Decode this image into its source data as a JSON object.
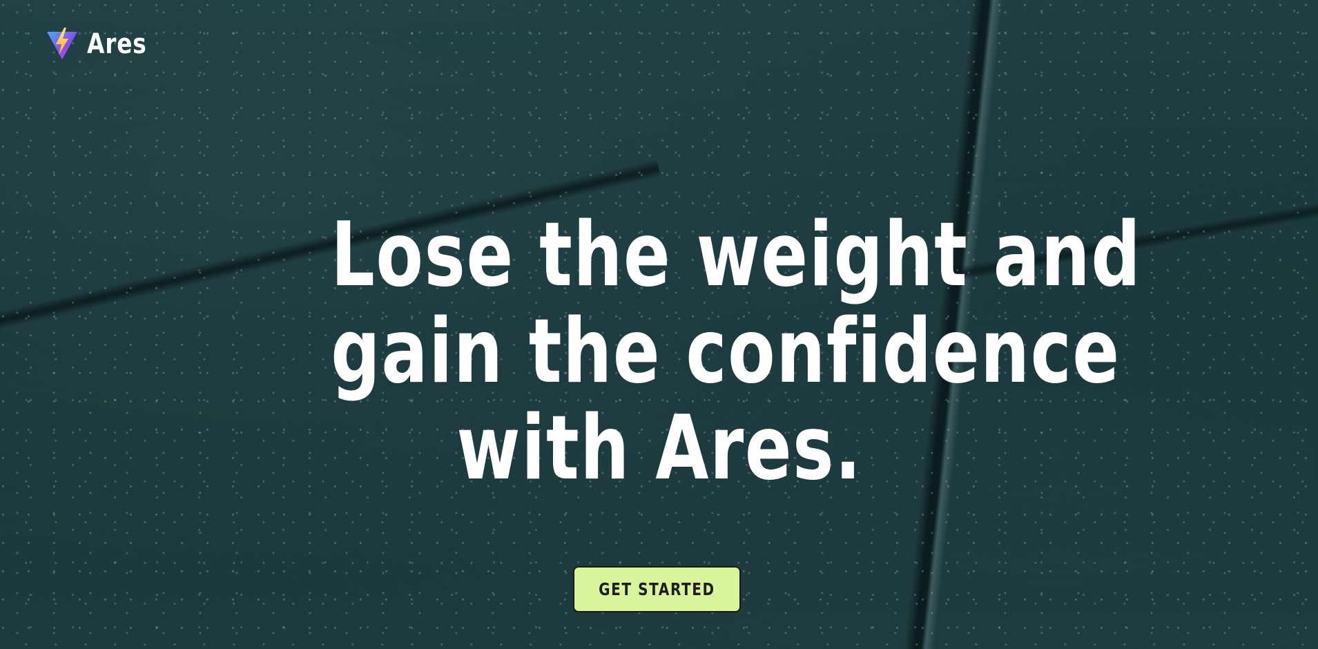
{
  "brand": {
    "name": "Ares",
    "logo_icon": "triangle-bolt-logo-icon"
  },
  "hero": {
    "title_lines": [
      "Lose the weight and",
      "gain the confidence",
      "with Ares."
    ]
  },
  "cta": {
    "label": "GET STARTED"
  },
  "colors": {
    "background": "#1c3a3d",
    "heading": "#ffffff",
    "cta_background": "#d9f59a",
    "cta_text": "#1e1e1e",
    "logo_purple": "#8a4df0",
    "logo_yellow": "#ffd43b"
  }
}
